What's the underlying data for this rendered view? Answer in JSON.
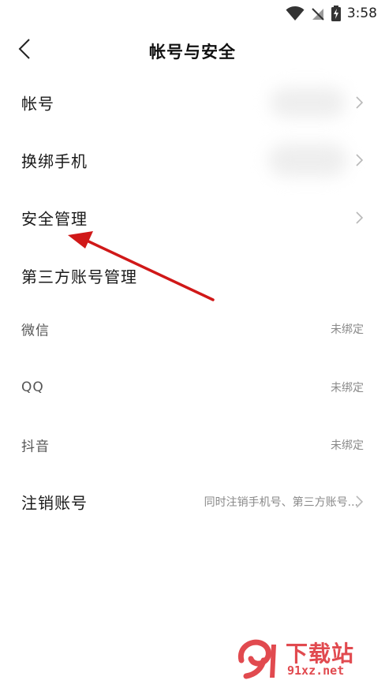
{
  "status_bar": {
    "time": "3:58",
    "icons": [
      "wifi-icon",
      "no-signal-icon",
      "battery-charging-icon"
    ]
  },
  "nav": {
    "back_icon": "chevron-left-icon",
    "title": "帐号与安全"
  },
  "rows": {
    "account": {
      "label": "帐号",
      "value": ""
    },
    "change_phone": {
      "label": "换绑手机",
      "value": ""
    },
    "security": {
      "label": "安全管理"
    }
  },
  "third_party": {
    "title": "第三方账号管理",
    "items": [
      {
        "label": "微信",
        "status": "未绑定"
      },
      {
        "label": "QQ",
        "status": "未绑定"
      },
      {
        "label": "抖音",
        "status": "未绑定"
      }
    ]
  },
  "deactivate": {
    "label": "注销账号",
    "hint": "同时注销手机号、第三方账号..."
  },
  "watermark": {
    "title": "下载站",
    "site": "91xz.net"
  },
  "colors": {
    "accent_arrow": "#d01818",
    "watermark": "#e14a4f",
    "muted_text": "#8a8a8a"
  }
}
